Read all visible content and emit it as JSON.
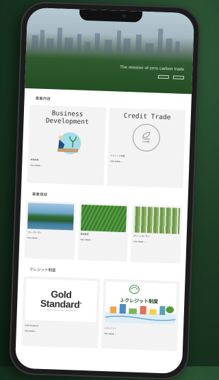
{
  "hero": {
    "tagline": "The mission of zero carbon trade",
    "buttons": [
      "",
      ""
    ]
  },
  "sections": {
    "business_title": "事業内容",
    "projects_title": "事業領域",
    "credits_title": "クレジット制度"
  },
  "business_cards": [
    {
      "heading": "Business\nDevelopment",
      "category": "事業開発",
      "link": "View details →"
    },
    {
      "heading": "Credit Trade",
      "category": "クレジット売買",
      "link": "View details →",
      "badge": "Carbon\nCredits"
    }
  ],
  "project_cards": [
    {
      "title": "ブルーカーボン",
      "link": "View details →"
    },
    {
      "title": "森林管理",
      "link": "View details →"
    },
    {
      "title": "グリーンカーボン",
      "link": "View details →"
    }
  ],
  "credit_cards": [
    {
      "logo": "Gold\nStandard",
      "logo_tm": "®",
      "logo_sub": "The best standard for climate and development",
      "name": "Gold Standard",
      "link": "View details →"
    },
    {
      "logo": "J-クレジット制度",
      "name": "J-クレジット",
      "link": "View details →"
    }
  ],
  "colors": {
    "background": "#1c3a24",
    "hero_forest": "#2f5a2f",
    "card_bg": "#f3f3f3",
    "j_credit_green": "#1d4b1d"
  },
  "icons": [
    "camera-icon",
    "planting-illustration",
    "carbon-credits-badge"
  ]
}
